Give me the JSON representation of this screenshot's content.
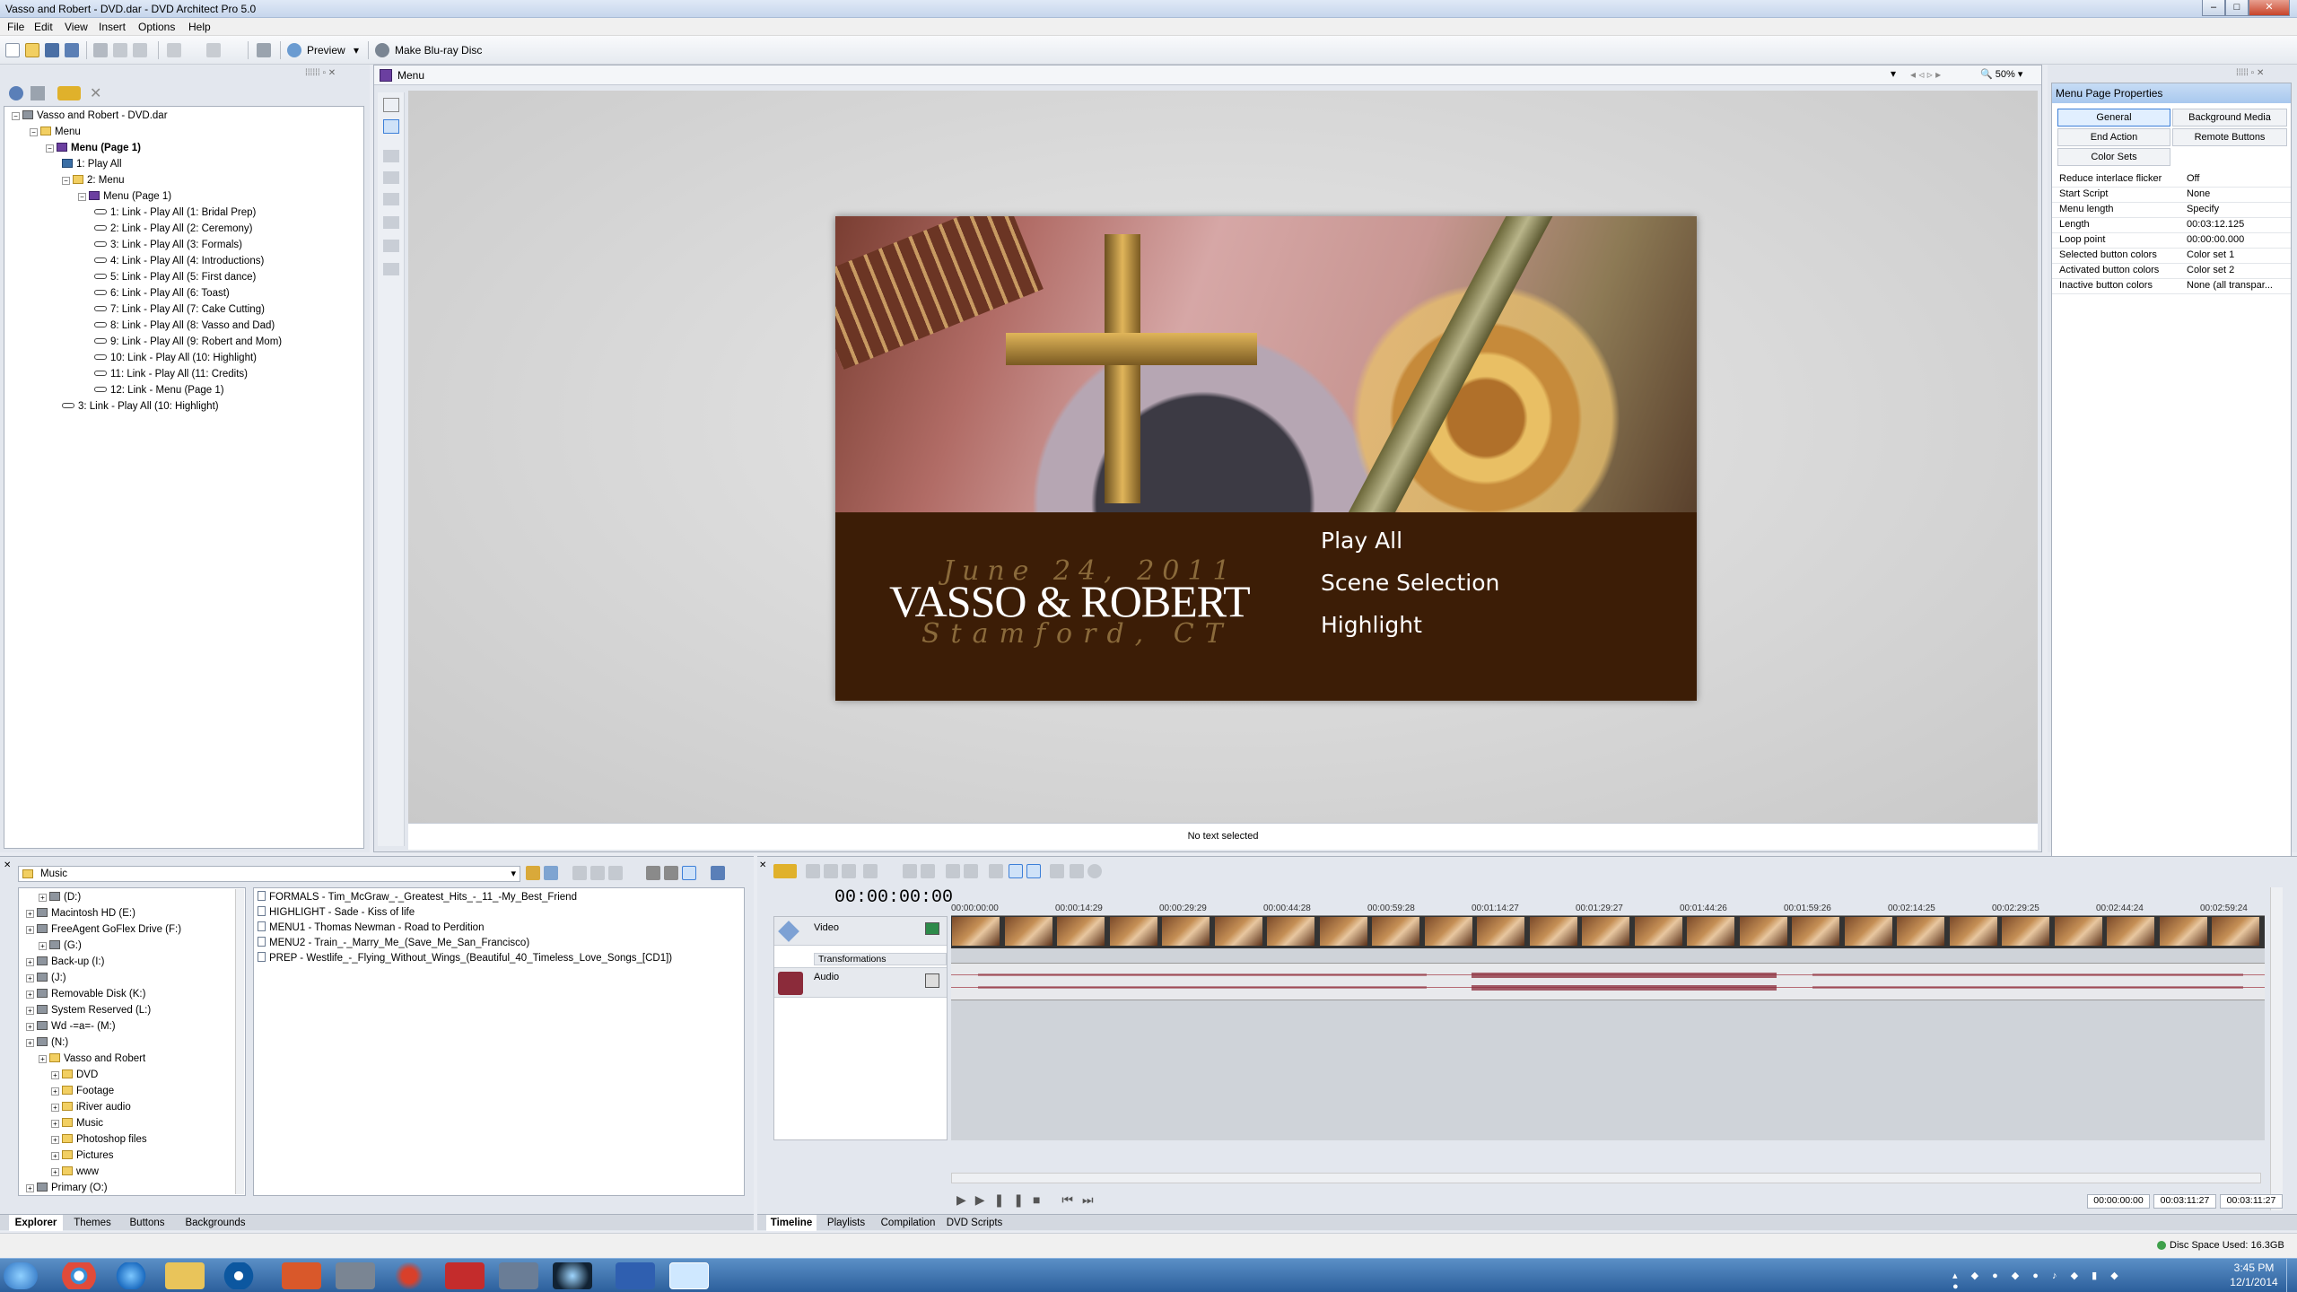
{
  "window": {
    "title": "Vasso and Robert - DVD.dar - DVD Architect Pro 5.0",
    "min": "–",
    "max": "□",
    "close": "✕"
  },
  "menubar": [
    "File",
    "Edit",
    "View",
    "Insert",
    "Options",
    "Help"
  ],
  "toolbar": {
    "preview": "Preview",
    "make": "Make Blu-ray Disc"
  },
  "project_tree": {
    "root": "Vasso and Robert - DVD.dar",
    "items": [
      {
        "label": "Menu",
        "type": "folder",
        "depth": 1
      },
      {
        "label": "Menu (Page 1)",
        "type": "menu",
        "depth": 2,
        "bold": true
      },
      {
        "label": "1: Play All",
        "type": "pl",
        "depth": 3
      },
      {
        "label": "2: Menu",
        "type": "folder",
        "depth": 3
      },
      {
        "label": "Menu (Page 1)",
        "type": "menu",
        "depth": 4
      },
      {
        "label": "1: Link - Play All (1: Bridal Prep)",
        "type": "link",
        "depth": 5
      },
      {
        "label": "2: Link - Play All (2: Ceremony)",
        "type": "link",
        "depth": 5
      },
      {
        "label": "3: Link - Play All (3: Formals)",
        "type": "link",
        "depth": 5
      },
      {
        "label": "4: Link - Play All (4: Introductions)",
        "type": "link",
        "depth": 5
      },
      {
        "label": "5: Link - Play All (5: First dance)",
        "type": "link",
        "depth": 5
      },
      {
        "label": "6: Link - Play All (6: Toast)",
        "type": "link",
        "depth": 5
      },
      {
        "label": "7: Link - Play All (7: Cake Cutting)",
        "type": "link",
        "depth": 5
      },
      {
        "label": "8: Link - Play All (8: Vasso and Dad)",
        "type": "link",
        "depth": 5
      },
      {
        "label": "9: Link - Play All (9: Robert and Mom)",
        "type": "link",
        "depth": 5
      },
      {
        "label": "10: Link - Play All (10: Highlight)",
        "type": "link",
        "depth": 5
      },
      {
        "label": "11: Link - Play All (11: Credits)",
        "type": "link",
        "depth": 5
      },
      {
        "label": "12: Link - Menu (Page 1)",
        "type": "link",
        "depth": 5
      },
      {
        "label": "3: Link - Play All (10: Highlight)",
        "type": "link",
        "depth": 3
      }
    ]
  },
  "workspace": {
    "tab": "Menu",
    "zoom": "50%",
    "status": "No text selected"
  },
  "menu_preview": {
    "date": "June 24, 2011",
    "names": "VASSO & ROBERT",
    "place": "Stamford, CT",
    "buttons": [
      "Play All",
      "Scene Selection",
      "Highlight"
    ]
  },
  "properties": {
    "title": "Menu Page Properties",
    "tabs": [
      "General",
      "Background Media",
      "End Action",
      "Remote Buttons",
      "Color Sets"
    ],
    "rows": [
      {
        "k": "Reduce interlace flicker",
        "v": "Off"
      },
      {
        "k": "Start Script",
        "v": "None"
      },
      {
        "k": "Menu length",
        "v": "Specify"
      },
      {
        "k": "Length",
        "v": "00:03:12.125"
      },
      {
        "k": "Loop point",
        "v": "00:00:00.000"
      },
      {
        "k": "Selected button colors",
        "v": "Color set 1"
      },
      {
        "k": "Activated button colors",
        "v": "Color set 2"
      },
      {
        "k": "Inactive button colors",
        "v": "None (all transpar..."
      }
    ]
  },
  "explorer": {
    "path": "Music",
    "tree": [
      {
        "label": "(D:)",
        "depth": 1,
        "type": "drive"
      },
      {
        "label": "Macintosh HD (E:)",
        "depth": 0,
        "type": "drive"
      },
      {
        "label": "FreeAgent GoFlex Drive (F:)",
        "depth": 0,
        "type": "drive"
      },
      {
        "label": "(G:)",
        "depth": 1,
        "type": "drive"
      },
      {
        "label": "Back-up (I:)",
        "depth": 0,
        "type": "drive"
      },
      {
        "label": "(J:)",
        "depth": 0,
        "type": "drive"
      },
      {
        "label": "Removable Disk (K:)",
        "depth": 0,
        "type": "drive"
      },
      {
        "label": "System Reserved (L:)",
        "depth": 0,
        "type": "drive"
      },
      {
        "label": "Wd -=a=- (M:)",
        "depth": 0,
        "type": "drive"
      },
      {
        "label": "(N:)",
        "depth": 0,
        "type": "drive"
      },
      {
        "label": "Vasso and Robert",
        "depth": 1,
        "type": "folder"
      },
      {
        "label": "DVD",
        "depth": 2,
        "type": "folder"
      },
      {
        "label": "Footage",
        "depth": 2,
        "type": "folder"
      },
      {
        "label": "iRiver audio",
        "depth": 2,
        "type": "folder"
      },
      {
        "label": "Music",
        "depth": 2,
        "type": "folder"
      },
      {
        "label": "Photoshop files",
        "depth": 2,
        "type": "folder"
      },
      {
        "label": "Pictures",
        "depth": 2,
        "type": "folder"
      },
      {
        "label": "www",
        "depth": 2,
        "type": "folder"
      },
      {
        "label": "Primary (O:)",
        "depth": 0,
        "type": "drive"
      }
    ],
    "files": [
      "FORMALS - Tim_McGraw_-_Greatest_Hits_-_11_-My_Best_Friend",
      "HIGHLIGHT - Sade - Kiss of life",
      "MENU1 - Thomas Newman - Road to Perdition",
      "MENU2 - Train_-_Marry_Me_(Save_Me_San_Francisco)",
      "PREP - Westlife_-_Flying_Without_Wings_(Beautiful_40_Timeless_Love_Songs_[CD1])"
    ],
    "tabs": [
      "Explorer",
      "Themes",
      "Buttons",
      "Backgrounds"
    ]
  },
  "timeline": {
    "timecode": "00:00:00:00",
    "ruler": [
      "00:00:00:00",
      "00:00:14:29",
      "00:00:29:29",
      "00:00:44:28",
      "00:00:59:28",
      "00:01:14:27",
      "00:01:29:27",
      "00:01:44:26",
      "00:01:59:26",
      "00:02:14:25",
      "00:02:29:25",
      "00:02:44:24",
      "00:02:59:24"
    ],
    "tracks": {
      "video": "Video",
      "transform": "Transformations",
      "audio": "Audio"
    },
    "tc_fields": [
      "00:00:00:00",
      "00:03:11:27",
      "00:03:11:27"
    ],
    "tabs": [
      "Timeline",
      "Playlists",
      "Compilation",
      "DVD Scripts"
    ]
  },
  "statusbar": {
    "disc": "Disc Space Used: 16.3GB"
  },
  "taskbar": {
    "time": "3:45 PM",
    "date": "12/1/2014"
  }
}
